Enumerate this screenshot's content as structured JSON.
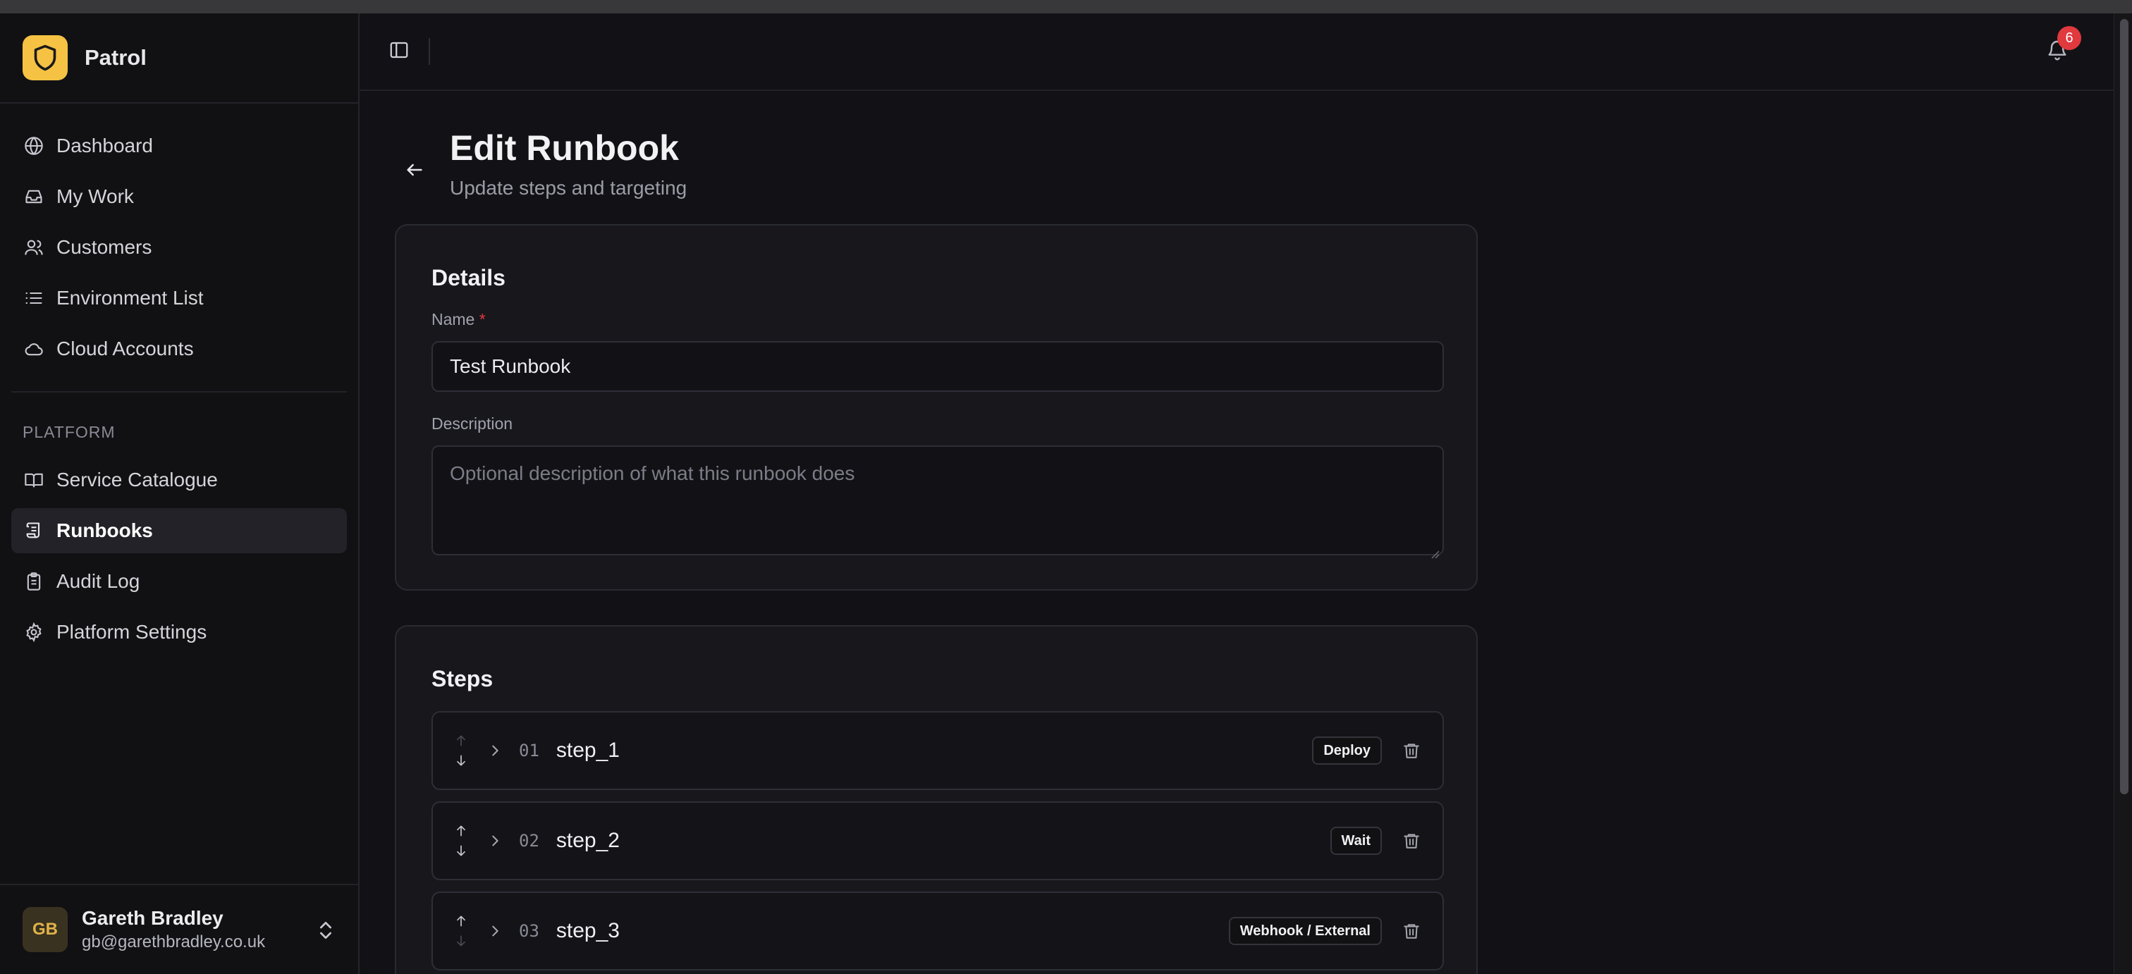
{
  "app": {
    "name": "Patrol"
  },
  "nav": {
    "main_items": [
      {
        "label": "Dashboard",
        "icon": "globe-icon"
      },
      {
        "label": "My Work",
        "icon": "inbox-icon"
      },
      {
        "label": "Customers",
        "icon": "users-icon"
      },
      {
        "label": "Environment List",
        "icon": "list-icon"
      },
      {
        "label": "Cloud Accounts",
        "icon": "cloud-icon"
      }
    ],
    "platform_label": "PLATFORM",
    "platform_items": [
      {
        "label": "Service Catalogue",
        "icon": "book-icon"
      },
      {
        "label": "Runbooks",
        "icon": "scroll-icon",
        "active": true
      },
      {
        "label": "Audit Log",
        "icon": "clipboard-icon"
      },
      {
        "label": "Platform Settings",
        "icon": "gear-icon"
      }
    ]
  },
  "user": {
    "initials": "GB",
    "name": "Gareth Bradley",
    "email": "gb@garethbradley.co.uk"
  },
  "notifications": {
    "count": "6"
  },
  "page": {
    "title": "Edit Runbook",
    "subtitle": "Update steps and targeting"
  },
  "details": {
    "title": "Details",
    "name_label": "Name",
    "required_mark": "*",
    "name_value": "Test Runbook",
    "description_label": "Description",
    "description_placeholder": "Optional description of what this runbook does"
  },
  "steps": {
    "title": "Steps",
    "items": [
      {
        "number": "01",
        "name": "step_1",
        "type": "Deploy"
      },
      {
        "number": "02",
        "name": "step_2",
        "type": "Wait"
      },
      {
        "number": "03",
        "name": "step_3",
        "type": "Webhook / External"
      }
    ]
  },
  "colors": {
    "accent": "#f5c244",
    "danger": "#e0393e",
    "background": "#121216"
  }
}
